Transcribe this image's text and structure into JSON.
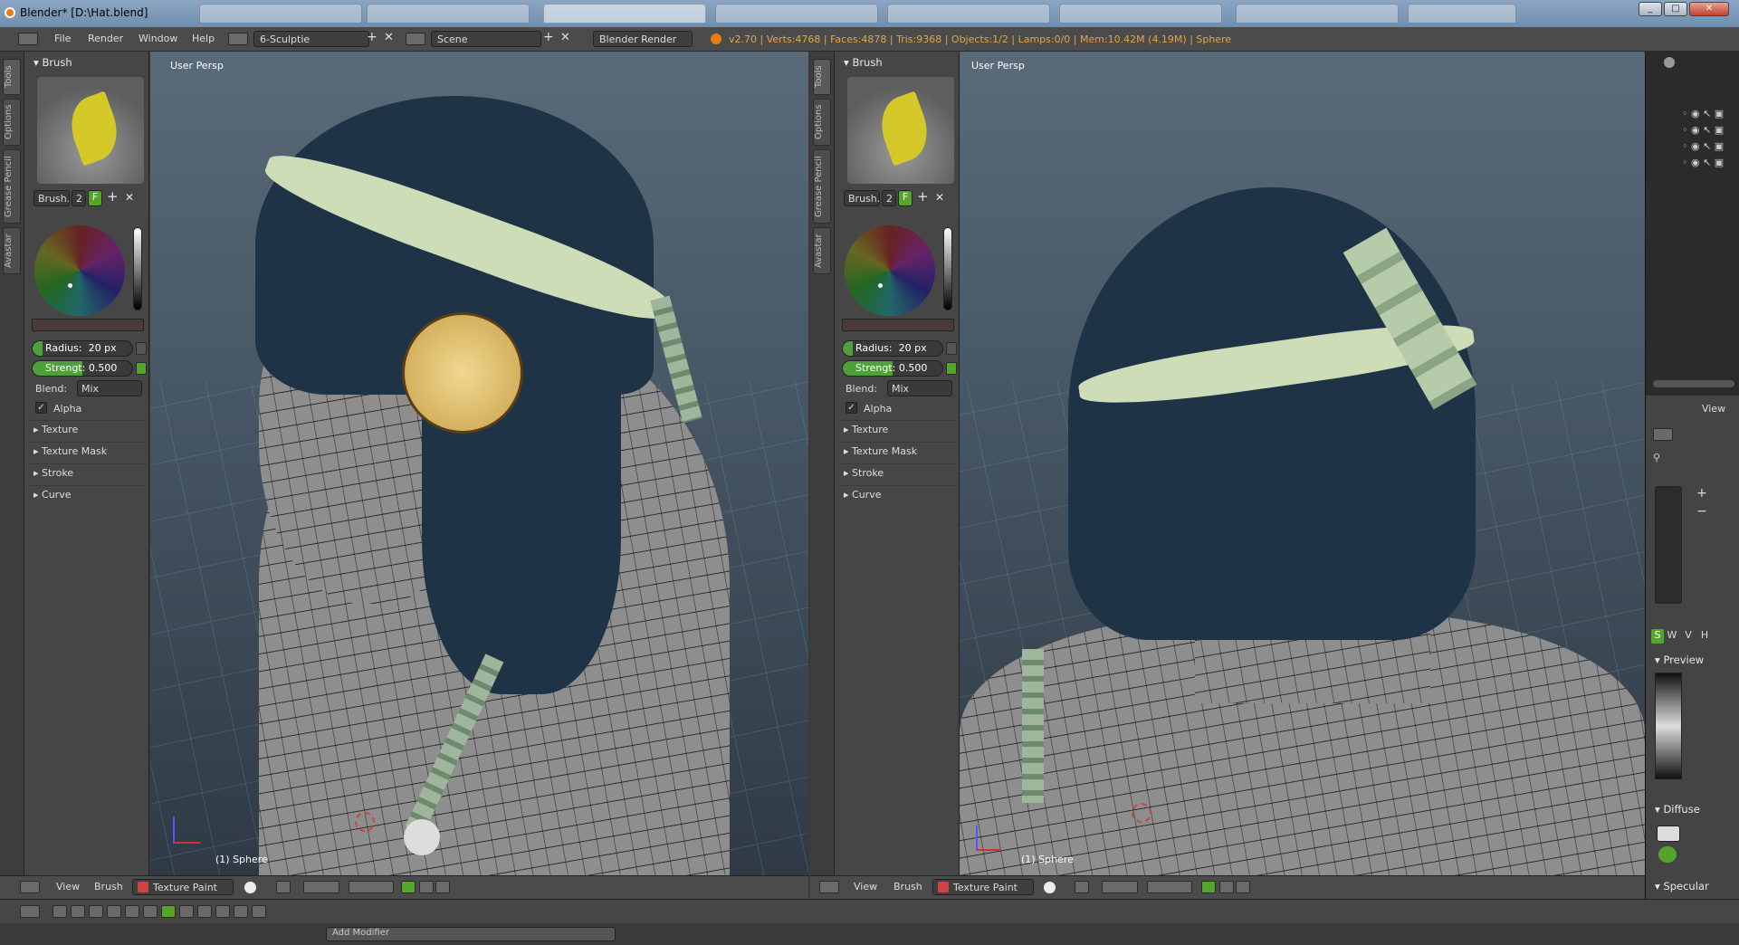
{
  "window": {
    "title": "Blender* [D:\\Hat.blend]"
  },
  "menubar": {
    "menus": [
      "File",
      "Render",
      "Window",
      "Help"
    ],
    "screen_layout": "6-Sculptie",
    "scene": "Scene",
    "engine": "Blender Render",
    "stats": "v2.70 | Verts:4768 | Faces:4878 | Tris:9368 | Objects:1/2 | Lamps:0/0 | Mem:10.42M (4.19M) | Sphere"
  },
  "left_panel": {
    "tabs": [
      "Tools",
      "Options",
      "Grease Pencil",
      "Avastar"
    ],
    "brush_header": "Brush",
    "brush_name": "Brush.",
    "brush_users": "2",
    "fake_user": "F",
    "radius_label": "Radius:",
    "radius_value": "20 px",
    "strength_label": "Strengt:",
    "strength_value": "0.500",
    "strength_fraction": 0.5,
    "blend_label": "Blend:",
    "blend_value": "Mix",
    "alpha_label": "Alpha",
    "sections": [
      "Texture",
      "Texture Mask",
      "Stroke",
      "Curve"
    ]
  },
  "viewports": [
    {
      "label": "User Persp",
      "object": "(1) Sphere"
    },
    {
      "label": "User Persp",
      "object": "(1) Sphere"
    }
  ],
  "viewport_header": {
    "menus": [
      "View",
      "Brush"
    ],
    "mode": "Texture Paint"
  },
  "props_panel": {
    "view_label": "View",
    "swvh": [
      "S",
      "W",
      "V",
      "H"
    ],
    "preview_header": "Preview",
    "diffuse_header": "Diffuse",
    "specular_header": "Specular"
  },
  "taskbar": {
    "add_modifier": "Add Modifier"
  },
  "colors": {
    "accent_green": "#55a52c",
    "stats_orange": "#e4a44a",
    "hat_navy": "#1e3446",
    "hat_band": "#cfdcb8"
  }
}
